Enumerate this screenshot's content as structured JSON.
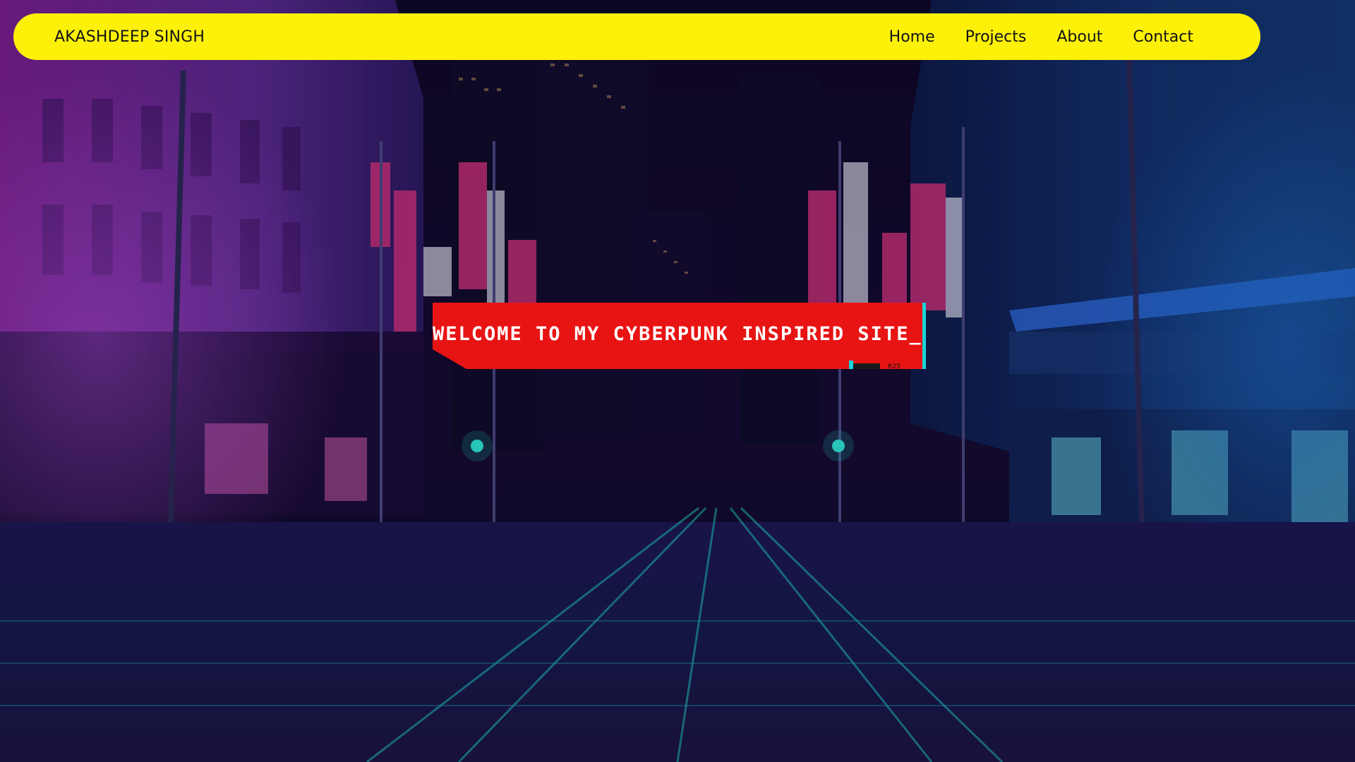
{
  "navbar": {
    "brand": "AKASHDEEP SINGH",
    "links": [
      {
        "label": "Home"
      },
      {
        "label": "Projects"
      },
      {
        "label": "About"
      },
      {
        "label": "Contact"
      }
    ]
  },
  "hero": {
    "title": "WELCOME TO MY CYBERPUNK INSPIRED SITE_",
    "tag": "R25"
  },
  "colors": {
    "navbar_bg": "#fdf10a",
    "banner_red": "#e81414",
    "banner_cyan": "#19d5d8",
    "text_dark": "#121212"
  },
  "background": {
    "description_icon": "city-street-night-photo"
  }
}
